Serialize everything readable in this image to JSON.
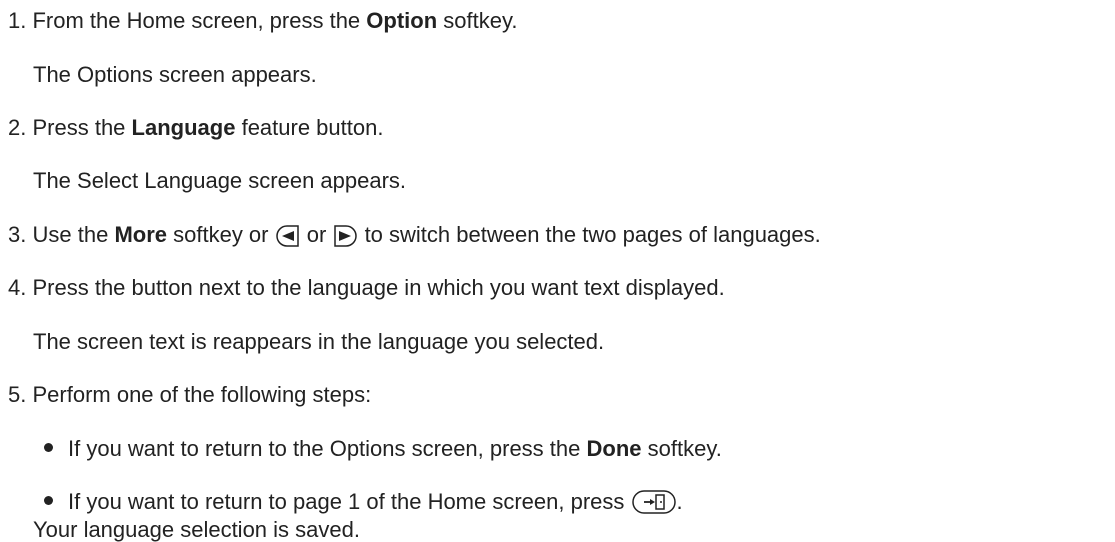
{
  "steps": [
    {
      "number": "1.",
      "text_before": "From the Home screen, press the",
      "bold": "Option",
      "text_after": "softkey.",
      "result": "The Options screen appears."
    },
    {
      "number": "2.",
      "text_before": "Press the",
      "bold": "Language",
      "text_after": "feature button.",
      "result": "The Select Language screen appears."
    },
    {
      "number": "3.",
      "text_before": "Use the",
      "bold": "More",
      "text_middle": "softkey or",
      "text_or": "or",
      "text_after": "to switch between the two pages of languages.",
      "icon_left": "left-arrow-key-icon",
      "icon_right": "right-arrow-key-icon"
    },
    {
      "number": "4.",
      "text": "Press the button next to the language in which you want text displayed.",
      "result": "The screen text is reappears in the language you selected."
    },
    {
      "number": "5.",
      "text": "Perform one of the following steps:",
      "bullets": [
        {
          "text_before": "If you want to return to the Options screen, press the",
          "bold": "Done",
          "text_after": "softkey."
        },
        {
          "text_before": "If you want to return to page 1 of the Home screen, press",
          "icon": "exit-key-icon",
          "text_after": "."
        }
      ],
      "result": "Your language selection is saved."
    }
  ],
  "colors": {
    "text": "#222222",
    "background": "#ffffff"
  }
}
